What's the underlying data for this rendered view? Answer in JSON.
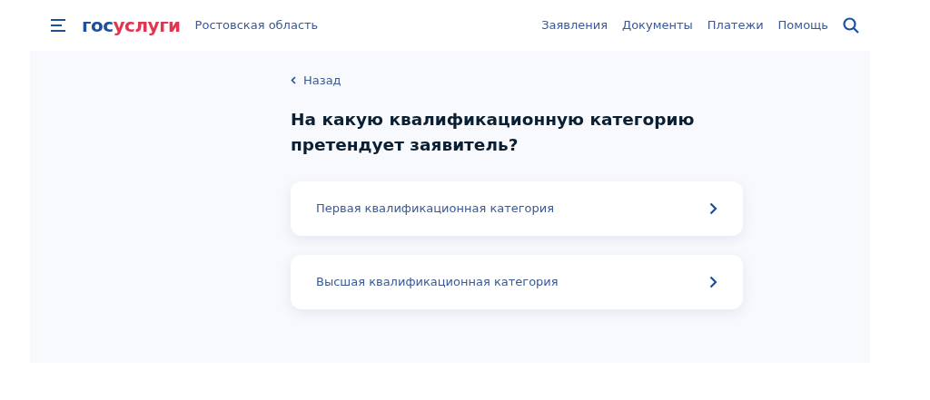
{
  "header": {
    "logo": {
      "prefix": "гос",
      "suffix": "услуги"
    },
    "region": "Ростовская область",
    "nav": [
      "Заявления",
      "Документы",
      "Платежи",
      "Помощь"
    ]
  },
  "back": "Назад",
  "question": "На какую квалификационную категорию претендует заявитель?",
  "options": [
    {
      "label": "Первая квалификационная категория"
    },
    {
      "label": "Высшая квалификационная категория"
    }
  ]
}
